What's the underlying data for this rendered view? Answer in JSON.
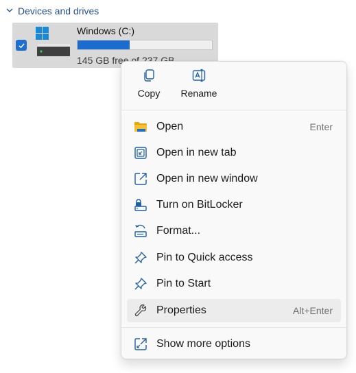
{
  "section": {
    "title": "Devices and drives",
    "chevron_icon": "chevron-down-icon"
  },
  "drive": {
    "name": "Windows (C:)",
    "free_text": "145 GB free of 237 GB",
    "used_fraction": 0.39,
    "selected": true,
    "icon": "hard-drive-windows-icon"
  },
  "context_menu": {
    "quick_actions": [
      {
        "label": "Copy",
        "icon": "copy-icon"
      },
      {
        "label": "Rename",
        "icon": "rename-icon"
      }
    ],
    "items": [
      {
        "label": "Open",
        "accelerator": "Enter",
        "icon": "folder-icon"
      },
      {
        "label": "Open in new tab",
        "accelerator": "",
        "icon": "open-new-tab-icon"
      },
      {
        "label": "Open in new window",
        "accelerator": "",
        "icon": "open-new-window-icon"
      },
      {
        "label": "Turn on BitLocker",
        "accelerator": "",
        "icon": "bitlocker-icon"
      },
      {
        "label": "Format...",
        "accelerator": "",
        "icon": "format-icon"
      },
      {
        "label": "Pin to Quick access",
        "accelerator": "",
        "icon": "pin-icon"
      },
      {
        "label": "Pin to Start",
        "accelerator": "",
        "icon": "pin-icon"
      },
      {
        "label": "Properties",
        "accelerator": "Alt+Enter",
        "icon": "wrench-icon"
      }
    ],
    "more": {
      "label": "Show more options",
      "icon": "show-more-icon"
    }
  },
  "colors": {
    "accent": "#1a6dcf",
    "folder": "#f3b928",
    "section_header": "#1f4f8f"
  }
}
